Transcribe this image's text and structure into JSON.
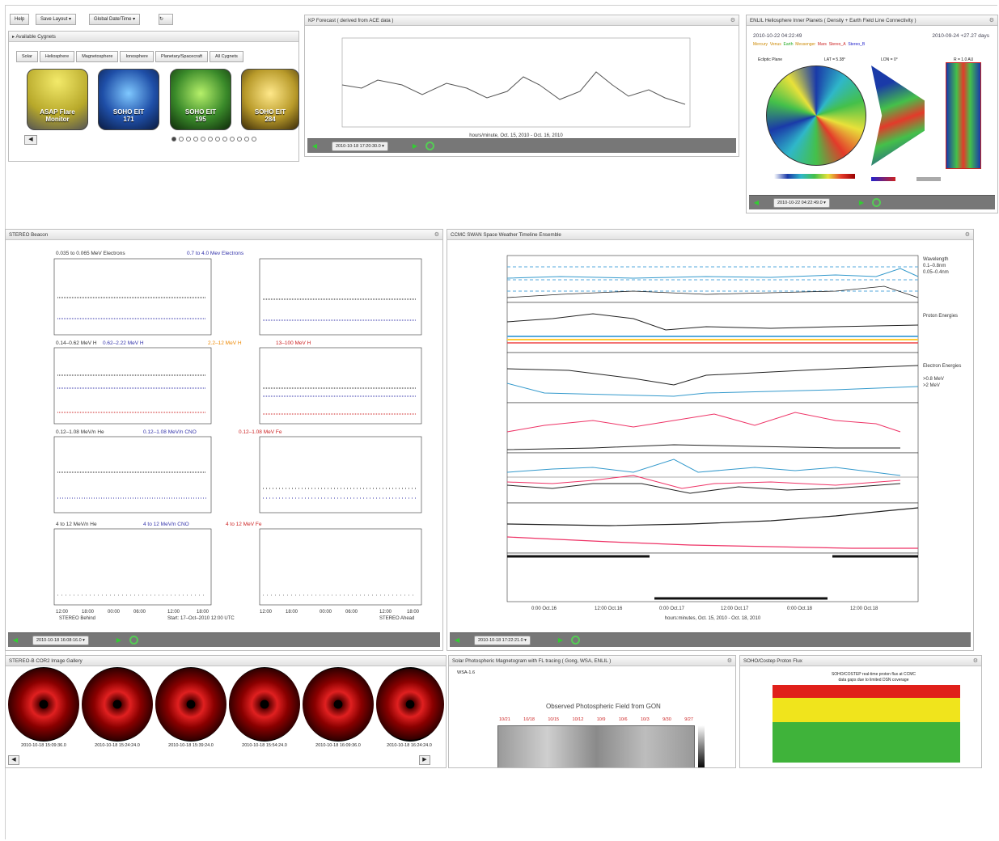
{
  "toolbar": {
    "help": "Help",
    "save_layout": "Save Layout ▾",
    "global_date": "Global Date/Time ▾"
  },
  "cygnets": {
    "section_title": "▸ Available Cygnets",
    "tabs": [
      "Solar",
      "Heliosphere",
      "Magnetosphere",
      "Ionosphere",
      "Planetary/Spacecraft",
      "All Cygnets"
    ],
    "tiles": [
      {
        "l1": "ASAP Flare",
        "l2": "Monitor",
        "color": "#d4c63a"
      },
      {
        "l1": "SOHO EIT",
        "l2": "171",
        "color": "#1f4fa8"
      },
      {
        "l1": "SOHO EIT",
        "l2": "195",
        "color": "#3a8a2a"
      },
      {
        "l1": "SOHO EIT",
        "l2": "284",
        "color": "#b89a2a"
      }
    ]
  },
  "kp": {
    "title": "KP Forecast ( derived from ACE data )",
    "xlabel": "hours/minute, Oct. 15, 2010 - Oct. 16, 2010",
    "date": "2010-10-18 17:20:30.0 ▾"
  },
  "enlil": {
    "title": "ENLIL Heliosphere Inner Planets ( Density + Earth Field Line Connectivity )",
    "left_date": "2010-10-22 04:22:49",
    "right_date": "2010-09-24 +27.27 days",
    "legend": [
      "Mercury",
      "Venus",
      "Earth",
      "Messenger",
      "Mars",
      "Stereo_A",
      "Stereo_B"
    ],
    "ecliptic": "Ecliptic Plane",
    "lat": "LAT = 5.38°",
    "lon": "LON = 0°",
    "r": "R = 1.0 AU",
    "date": "2010-10-22 04:22:49.0 ▾"
  },
  "stereo": {
    "title": "STEREO Beacon",
    "row_labels": [
      [
        "0.035 to 0.065 MeV Electrons",
        "0.7 to 4.0 Mev Electrons"
      ],
      [
        "0.14–0.62 MeV H",
        "0.62–2.22 MeV H",
        "2.2–12 MeV H",
        "13–100 MeV H"
      ],
      [
        "0.12–1.08 MeV/n He",
        "0.12–1.08 MeV/n CNO",
        "0.12–1.08 MeV Fe"
      ],
      [
        "4 to 12 MeV/n He",
        "4 to 12 MeV/n CNO",
        "4 to 12 MeV Fe"
      ]
    ],
    "xticks": [
      "12:00",
      "18:00",
      "00:00",
      "06:00",
      "12:00",
      "18:00"
    ],
    "start": "Start: 17–Oct–2010 12:00 UTC",
    "behind": "STEREO Behind",
    "ahead": "STEREO Ahead",
    "date": "2010-10-18 16:08:16.0 ▾"
  },
  "ccmc": {
    "title": "CCMC SWAN Space Weather Timeline Ensemble",
    "right_labels": [
      "Wavelength",
      "0.1–0.8nm",
      "0.05–0.4nm",
      "Proton Energies",
      "Electron Energies",
      ">0.8 MeV",
      ">2 MeV"
    ],
    "xticks": [
      "0:00 Oct.16",
      "12:00 Oct.16",
      "0:00 Oct.17",
      "12:00 Oct.17",
      "0:00 Oct.18",
      "12:00 Oct.18"
    ],
    "xlabel": "hours:minutes, Oct. 15, 2010 - Oct. 18, 2010",
    "date": "2010-10-18 17:22:21.0 ▾"
  },
  "cor2": {
    "title": "STEREO-B COR2 Image Gallery",
    "captions": [
      "2010-10-18 15:09:36.0",
      "2010-10-18 15:24:24.0",
      "2010-10-18 15:39:24.0",
      "2010-10-18 15:54:24.0",
      "2010-10-18 16:09:36.0",
      "2010-10-18 16:24:24.0"
    ]
  },
  "magneto": {
    "title": "Solar Photospheric Magnetogram with FL tracing ( Gong, WSA, ENLIL )",
    "subtitle": "Observed Photospheric Field from GON",
    "wsa": "WSA-1.6",
    "dates": [
      "10/21",
      "10/18",
      "10/15",
      "10/12",
      "10/9",
      "10/6",
      "10/3",
      "9/30",
      "9/27"
    ]
  },
  "proton": {
    "title": "SOHO/Costep Proton Flux",
    "head1": "SOHO/COSTEP real-time proton flux at CCMC",
    "head2": "data gaps due to limited DSN coverage"
  }
}
